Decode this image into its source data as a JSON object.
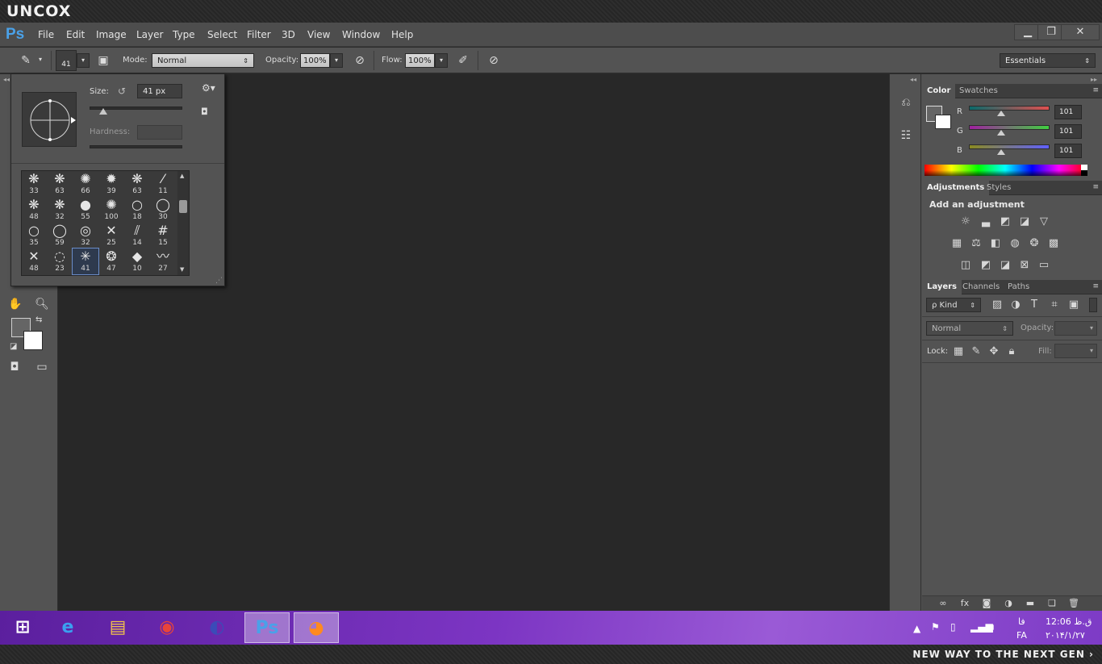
{
  "brand": {
    "logo": "UNCOX",
    "tagline": "NEW WAY TO THE NEXT GEN ›"
  },
  "app": {
    "logo": "Ps"
  },
  "menu": [
    "File",
    "Edit",
    "Image",
    "Layer",
    "Type",
    "Select",
    "Filter",
    "3D",
    "View",
    "Window",
    "Help"
  ],
  "window_controls": {
    "minimize": "▁",
    "restore": "❐",
    "close": "✕"
  },
  "options_bar": {
    "brush_size": "41",
    "mode_label": "Mode:",
    "mode_value": "Normal",
    "opacity_label": "Opacity:",
    "opacity_value": "100%",
    "flow_label": "Flow:",
    "flow_value": "100%",
    "workspace": "Essentials"
  },
  "brush_popup": {
    "size_label": "Size:",
    "size_value": "41 px",
    "hardness_label": "Hardness:",
    "size_slider": 0.15,
    "brushes": [
      {
        "glyph": "❋",
        "n": "33"
      },
      {
        "glyph": "❋",
        "n": "63"
      },
      {
        "glyph": "✺",
        "n": "66"
      },
      {
        "glyph": "✹",
        "n": "39"
      },
      {
        "glyph": "❋",
        "n": "63"
      },
      {
        "glyph": "⁄",
        "n": "11"
      },
      {
        "glyph": "❋",
        "n": "48"
      },
      {
        "glyph": "❋",
        "n": "32"
      },
      {
        "glyph": "●",
        "n": "55"
      },
      {
        "glyph": "✺",
        "n": "100"
      },
      {
        "glyph": "○",
        "n": "18"
      },
      {
        "glyph": "◯",
        "n": "30"
      },
      {
        "glyph": "○",
        "n": "35"
      },
      {
        "glyph": "◯",
        "n": "59"
      },
      {
        "glyph": "◎",
        "n": "32"
      },
      {
        "glyph": "✕",
        "n": "25"
      },
      {
        "glyph": "⫽",
        "n": "14"
      },
      {
        "glyph": "#",
        "n": "15"
      },
      {
        "glyph": "✕",
        "n": "48"
      },
      {
        "glyph": "◌",
        "n": "23"
      },
      {
        "glyph": "✳",
        "n": "41"
      },
      {
        "glyph": "❂",
        "n": "47"
      },
      {
        "glyph": "◆",
        "n": "10"
      },
      {
        "glyph": "〰",
        "n": "27"
      }
    ],
    "selected_index": 20
  },
  "color_panel": {
    "tabs": [
      "Color",
      "Swatches"
    ],
    "channels": [
      {
        "label": "R",
        "value": "101",
        "level": 0.4,
        "from": "#0a6a6a",
        "to": "#e05050"
      },
      {
        "label": "G",
        "value": "101",
        "level": 0.4,
        "from": "#a020a0",
        "to": "#40d040"
      },
      {
        "label": "B",
        "value": "101",
        "level": 0.4,
        "from": "#8a8a20",
        "to": "#6060ff"
      }
    ]
  },
  "adjustments_panel": {
    "tabs": [
      "Adjustments",
      "Styles"
    ],
    "title": "Add an adjustment",
    "rows": [
      [
        {
          "icon": "brightness-icon",
          "glyph": "☼"
        },
        {
          "icon": "levels-icon",
          "glyph": "▃"
        },
        {
          "icon": "curves-icon",
          "glyph": "◩"
        },
        {
          "icon": "exposure-icon",
          "glyph": "◪"
        },
        {
          "icon": "vibrance-icon",
          "glyph": "▽"
        }
      ],
      [
        {
          "icon": "hue-saturation-icon",
          "glyph": "▦"
        },
        {
          "icon": "color-balance-icon",
          "glyph": "⚖"
        },
        {
          "icon": "black-white-icon",
          "glyph": "◧"
        },
        {
          "icon": "photo-filter-icon",
          "glyph": "◍"
        },
        {
          "icon": "channel-mixer-icon",
          "glyph": "❂"
        },
        {
          "icon": "color-lookup-icon",
          "glyph": "▩"
        }
      ],
      [
        {
          "icon": "invert-icon",
          "glyph": "◫"
        },
        {
          "icon": "posterize-icon",
          "glyph": "◩"
        },
        {
          "icon": "threshold-icon",
          "glyph": "◪"
        },
        {
          "icon": "selective-color-icon",
          "glyph": "⊠"
        },
        {
          "icon": "gradient-map-icon",
          "glyph": "▭"
        }
      ]
    ]
  },
  "layers_panel": {
    "tabs": [
      "Layers",
      "Channels",
      "Paths"
    ],
    "kind_label": "ρ Kind",
    "blend_mode": "Normal",
    "opacity_label": "Opacity:",
    "lock_label": "Lock:",
    "fill_label": "Fill:",
    "bottom_icons": [
      {
        "icon": "link-layers-icon",
        "glyph": "∞"
      },
      {
        "icon": "fx-icon",
        "glyph": "fx"
      },
      {
        "icon": "add-mask-icon",
        "glyph": "◙"
      },
      {
        "icon": "adjustment-layer-icon",
        "glyph": "◑"
      },
      {
        "icon": "group-icon",
        "glyph": "▬"
      },
      {
        "icon": "new-layer-icon",
        "glyph": "❏"
      },
      {
        "icon": "delete-layer-icon",
        "glyph": "🗑"
      }
    ]
  },
  "taskbar": {
    "items": [
      {
        "icon": "windows-start-icon",
        "glyph": "⊞",
        "color": "#ffffff"
      },
      {
        "icon": "internet-explorer-icon",
        "glyph": "e",
        "color": "#3aa0f0"
      },
      {
        "icon": "file-explorer-icon",
        "glyph": "▤",
        "color": "#f3c44a"
      },
      {
        "icon": "chrome-icon",
        "glyph": "◉",
        "color": "#e8443a"
      },
      {
        "icon": "eclipse-icon",
        "glyph": "◐",
        "color": "#3b4bb8"
      },
      {
        "icon": "photoshop-icon",
        "glyph": "Ps",
        "color": "#4aa1e8"
      },
      {
        "icon": "firefox-icon",
        "glyph": "◕",
        "color": "#ff8a1f"
      }
    ],
    "tray": {
      "lang": "FA",
      "lang_rtl": "فا",
      "time": "12:06 ق.ظ",
      "date": "۲۰۱۴/۱/۲۷"
    }
  }
}
